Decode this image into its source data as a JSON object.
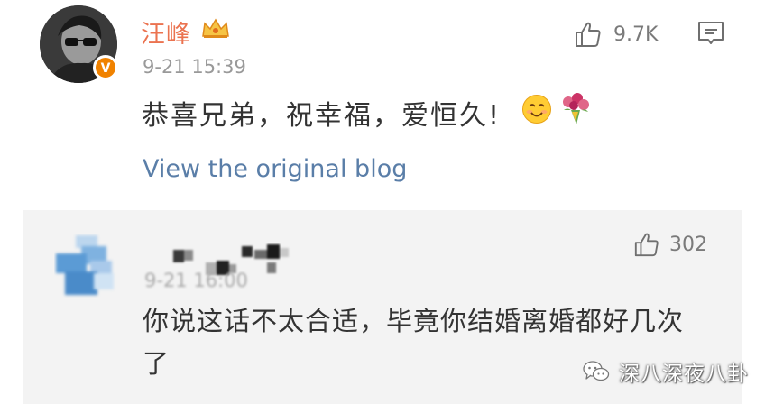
{
  "comment": {
    "username": "汪峰",
    "timestamp": "9-21 15:39",
    "like_count": "9.7K",
    "text": "恭喜兄弟，祝幸福，爱恒久!",
    "link_label": "View the original blog"
  },
  "reply": {
    "timestamp": "9-21 16:00",
    "like_count": "302",
    "text": "你说这话不太合适，毕竟你结婚离婚都好几次了"
  },
  "watermark": {
    "text": "深八深夜八卦"
  },
  "icons": {
    "like": "thumbs-up-icon",
    "comment": "comment-icon",
    "crown": "crown-icon",
    "verified": "verified-icon",
    "smile": "smile-emoji",
    "bouquet": "bouquet-emoji",
    "wechat": "wechat-icon"
  },
  "colors": {
    "username": "#eb7350",
    "link": "#5a7ea8",
    "reply_background": "#f3f3f3",
    "verified_badge": "#f08200"
  }
}
